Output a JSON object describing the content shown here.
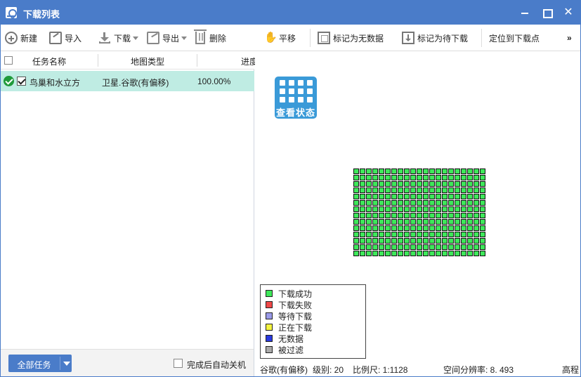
{
  "window": {
    "title": "下载列表",
    "close_glyph": "✕"
  },
  "toolbar": {
    "new_label": "新建",
    "import_label": "导入",
    "download_label": "下载",
    "export_label": "导出",
    "delete_label": "删除",
    "pan_label": "平移",
    "mark_nodata_label": "标记为无数据",
    "mark_pending_label": "标记为待下载",
    "locate_label": "定位到下载点",
    "more_label": "»"
  },
  "task_list": {
    "columns": [
      "任务名称",
      "地图类型",
      "进度"
    ],
    "rows": [
      {
        "name": "鸟巢和水立方",
        "map_type": "卫星.谷歌(有偏移)",
        "progress": "100.00%",
        "checked": true,
        "status": "success"
      }
    ]
  },
  "footer": {
    "all_tasks_label": "全部任务",
    "auto_shutdown_label": "完成后自动关机",
    "auto_shutdown_checked": false
  },
  "map": {
    "view_status_label": "查看状态",
    "tile_grid": {
      "columns": 21,
      "rows": 14,
      "state": "下载成功"
    },
    "legend": [
      {
        "label": "下载成功",
        "color": "#3ee85a"
      },
      {
        "label": "下载失败",
        "color": "#f04848"
      },
      {
        "label": "等待下载",
        "color": "#9a9ae8"
      },
      {
        "label": "正在下载",
        "color": "#f4f440"
      },
      {
        "label": "无数据",
        "color": "#2a3ae0"
      },
      {
        "label": "被过滤",
        "color": "#aaaaaa"
      }
    ]
  },
  "status_bar": {
    "map_name": "谷歌(有偏移)",
    "level": "级别: 20",
    "scale": "比例尺: 1:1128",
    "resolution": "空间分辨率: 8. 493",
    "elevation": "高程"
  }
}
